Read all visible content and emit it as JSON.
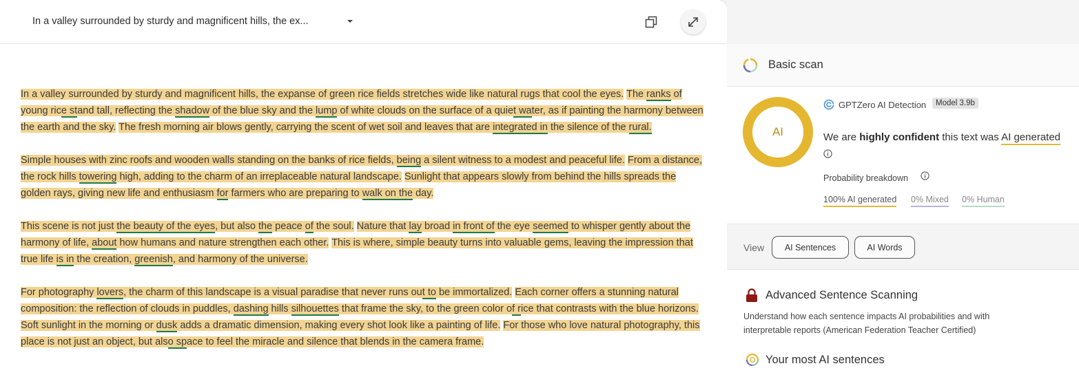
{
  "editor": {
    "title": "In a valley surrounded by sturdy and magnificent hills, the ex...",
    "icons": {
      "dropdown": "caret-down-icon",
      "copy": "copy-icon",
      "expand": "expand-arrows-icon"
    },
    "colors": {
      "highlight": "#f2d492",
      "underline": "#1e7a47"
    },
    "paragraphs": [
      {
        "sentences": [
          {
            "parts": [
              {
                "t": "In a valley surrounded by sturdy and magnificent hills, the expanse of green rice fields stretches wide like natural rugs that cool the eyes."
              }
            ]
          },
          {
            "parts": [
              {
                "t": "The "
              },
              {
                "t": "ranks",
                "u": true
              },
              {
                "t": " of young ric"
              },
              {
                "t": "e st",
                "u": true
              },
              {
                "t": "and tall, reflecting the "
              },
              {
                "t": "shadow",
                "u": true
              },
              {
                "t": " of the blue sky and the "
              },
              {
                "t": "lump",
                "u": true
              },
              {
                "t": " of white clouds on the surface of a quie"
              },
              {
                "t": "t wa",
                "u": true
              },
              {
                "t": "ter, as if painting the harmony between the earth and the sky."
              }
            ]
          },
          {
            "parts": [
              {
                "t": "The fresh morning air blows gently, carrying the scent of wet soil and leaves that are "
              },
              {
                "t": "integrated in",
                "u": true
              },
              {
                "t": " the silence of the "
              },
              {
                "t": "rural.",
                "u": true
              }
            ]
          }
        ]
      },
      {
        "sentences": [
          {
            "parts": [
              {
                "t": "Simple houses with zinc roofs and wooden walls standing on the banks of rice fields, "
              },
              {
                "t": "being",
                "u": true
              },
              {
                "t": " a silent witness to a modest and peaceful life."
              }
            ]
          },
          {
            "parts": [
              {
                "t": "From a distance, the rock hills "
              },
              {
                "t": "towering",
                "u": true
              },
              {
                "t": " high, adding to the charm of an irreplaceable natural landscape."
              }
            ]
          },
          {
            "parts": [
              {
                "t": "Sunlight that appears slowly from behind the hills spreads the golden rays, giving new life and enthusiasm "
              },
              {
                "t": "for",
                "u": true
              },
              {
                "t": " farmers who are preparing to "
              },
              {
                "t": "walk on the",
                "u": true
              },
              {
                "t": " day."
              }
            ]
          }
        ]
      },
      {
        "sentences": [
          {
            "parts": [
              {
                "t": "This scene is not just "
              },
              {
                "t": "the beauty of the eyes",
                "u": true
              },
              {
                "t": ", but also "
              },
              {
                "t": "the",
                "u": true
              },
              {
                "t": " peace "
              },
              {
                "t": "of",
                "u": true
              },
              {
                "t": " the soul."
              }
            ]
          },
          {
            "parts": [
              {
                "t": "Nature that "
              },
              {
                "t": "lay",
                "u": true
              },
              {
                "t": " broad "
              },
              {
                "t": "in front of",
                "u": true
              },
              {
                "t": " the eye "
              },
              {
                "t": "seemed",
                "u": true
              },
              {
                "t": " to whisper gently about the harmony of life, "
              },
              {
                "t": "about",
                "u": true
              },
              {
                "t": " how humans and nature strengthen each other."
              }
            ]
          },
          {
            "parts": [
              {
                "t": "This is where, simple beauty turns into valuable gems, leaving the impression that true life "
              },
              {
                "t": "is in",
                "u": true
              },
              {
                "t": " the creation, "
              },
              {
                "t": "greenish",
                "u": true
              },
              {
                "t": ", and harmony of the universe."
              }
            ]
          }
        ]
      },
      {
        "sentences": [
          {
            "parts": [
              {
                "t": "For photography "
              },
              {
                "t": "lovers",
                "u": true
              },
              {
                "t": ", the charm of this landscape is a visual paradise that never runs ou"
              },
              {
                "t": "t to",
                "u": true
              },
              {
                "t": " be immortalized."
              }
            ]
          },
          {
            "parts": [
              {
                "t": "Each corner offers a stunning natural composition: the reflection of clouds in puddles, "
              },
              {
                "t": "dashing",
                "u": true
              },
              {
                "t": " hills "
              },
              {
                "t": "silhouettes",
                "u": true
              },
              {
                "t": " that frame the sky, to the green color o"
              },
              {
                "t": "f r",
                "u": true
              },
              {
                "t": "ice that contrasts with the blue horizons."
              }
            ]
          },
          {
            "parts": [
              {
                "t": "Soft sunlight in the morning or "
              },
              {
                "t": "dusk",
                "u": true
              },
              {
                "t": " adds a dramatic dimension, making every shot look like a painting of life."
              }
            ]
          },
          {
            "parts": [
              {
                "t": "For those who love natural photography, this place is not just an object, but als"
              },
              {
                "t": "o sp",
                "u": true
              },
              {
                "t": "ace to feel the miracle and silence that blends in the camera frame."
              }
            ]
          }
        ]
      }
    ]
  },
  "results": {
    "basic_scan": {
      "label": "Basic scan",
      "icon": "spinner-ring-icon"
    },
    "ring_label": "AI",
    "ring_color": "#e5b731",
    "detector": {
      "icon": "gptzero-logo-icon",
      "name": "GPTZero AI Detection",
      "model": "Model 3.9b"
    },
    "confidence": {
      "prefix": "We are ",
      "strong": "highly confident",
      "middle": " this text was ",
      "result": "AI generated"
    },
    "probability_title": "Probability breakdown",
    "probabilities": {
      "ai": "100% AI generated",
      "mixed": "0% Mixed",
      "human": "0% Human"
    },
    "probability_colors": {
      "ai": "#e5b731",
      "mixed": "#b7b3d9",
      "human": "#b7dac3"
    },
    "view": {
      "label": "View",
      "sentences_button": "AI Sentences",
      "words_button": "AI Words"
    },
    "advanced": {
      "title": "Advanced Sentence Scanning",
      "description": "Understand how each sentence impacts AI probabilities and with interpretable reports (American Federation Teacher Certified)",
      "lock_icon": "lock-icon"
    },
    "most_ai": {
      "title": "Your most AI sentences",
      "icon": "gptzero-ring-icon"
    }
  }
}
